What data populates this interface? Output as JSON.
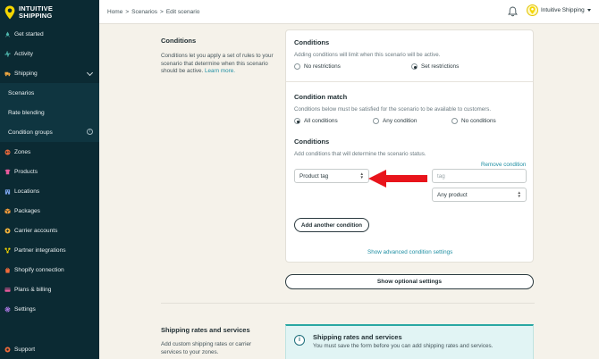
{
  "brand": {
    "line1": "INTUITIVE",
    "line2": "SHIPPING",
    "accent": "#f5d600"
  },
  "sidebar": {
    "items": [
      {
        "label": "Get started",
        "icon": "rocket-icon",
        "color": "#4db6ac"
      },
      {
        "label": "Activity",
        "icon": "activity-icon",
        "color": "#4db6ac"
      },
      {
        "label": "Shipping",
        "icon": "truck-icon",
        "color": "#f0a742"
      },
      {
        "label": "Scenarios"
      },
      {
        "label": "Rate blending"
      },
      {
        "label": "Condition groups"
      },
      {
        "label": "Zones",
        "icon": "globe-icon",
        "color": "#f06a3b"
      },
      {
        "label": "Products",
        "icon": "tag-icon",
        "color": "#e85a9c"
      },
      {
        "label": "Locations",
        "icon": "building-icon",
        "color": "#7aa2e8"
      },
      {
        "label": "Packages",
        "icon": "box-icon",
        "color": "#f09a3b"
      },
      {
        "label": "Carrier accounts",
        "icon": "carrier-icon",
        "color": "#f0b03b"
      },
      {
        "label": "Partner integrations",
        "icon": "integrations-icon",
        "color": "#f5d600"
      },
      {
        "label": "Shopify connection",
        "icon": "shopify-icon",
        "color": "#f06a3b"
      },
      {
        "label": "Plans & billing",
        "icon": "billing-icon",
        "color": "#e85a9c"
      },
      {
        "label": "Settings",
        "icon": "gear-icon",
        "color": "#b07ae8"
      }
    ],
    "support": {
      "label": "Support",
      "icon": "help-icon",
      "color": "#f06a3b"
    }
  },
  "topbar": {
    "breadcrumb": [
      "Home",
      ">",
      "Scenarios",
      ">",
      "Edit scenario"
    ],
    "account_name": "Intuitive Shipping"
  },
  "conditions_section": {
    "title": "Conditions",
    "description": "Conditions let you apply a set of rules to your scenario that determine when this scenario should be active.",
    "learn_more": "Learn more."
  },
  "card": {
    "conditions_title": "Conditions",
    "conditions_text": "Adding conditions will limit when this scenario will be active.",
    "radio_no_restrictions": "No restrictions",
    "radio_set_restrictions": "Set restrictions",
    "match_title": "Condition match",
    "match_text": "Conditions below must be satisfied for the scenario to be available to customers.",
    "radio_all": "All conditions",
    "radio_any": "Any condition",
    "radio_none": "No conditions",
    "list_title": "Conditions",
    "list_text": "Add conditions that will determine the scenario status.",
    "remove_condition": "Remove condition",
    "condition_type": "Product tag",
    "tag_placeholder": "tag",
    "product_match": "Any product",
    "add_condition": "Add another condition",
    "advanced_settings": "Show advanced condition settings"
  },
  "optional_settings_button": "Show optional settings",
  "shipping_section": {
    "title": "Shipping rates and services",
    "description": "Add custom shipping rates or carrier services to your zones.",
    "banner_title": "Shipping rates and services",
    "banner_text": "You must save the form before you can add shipping rates and services."
  }
}
